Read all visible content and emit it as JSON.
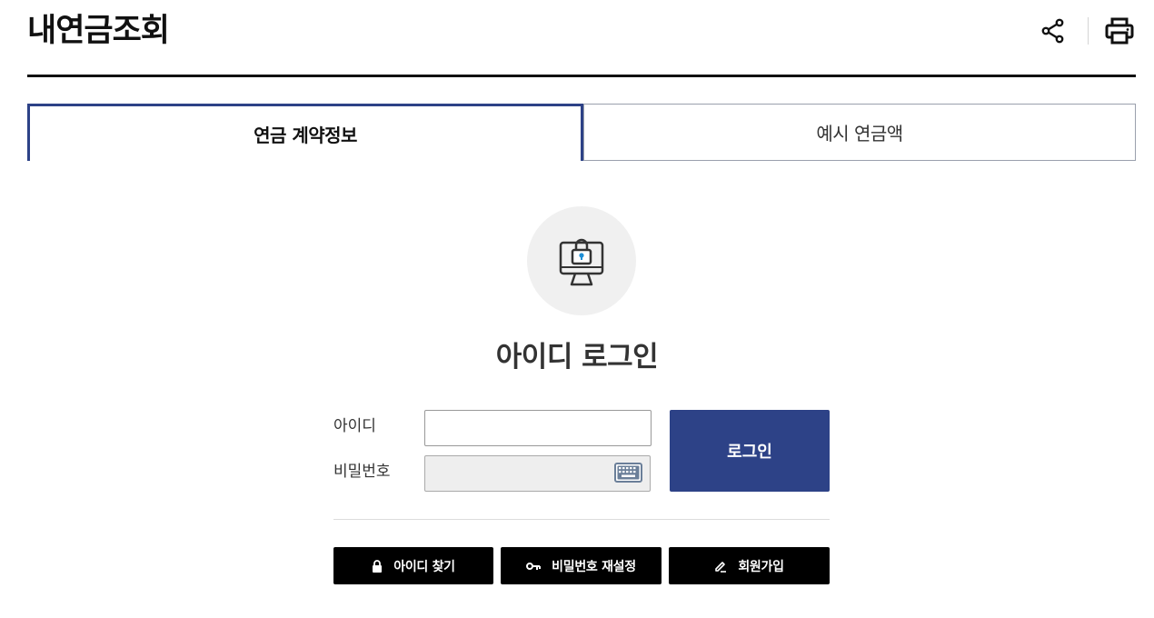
{
  "header": {
    "title": "내연금조회",
    "icons": [
      "share-icon",
      "print-icon"
    ]
  },
  "tabs": [
    {
      "label": "연금 계약정보",
      "active": true
    },
    {
      "label": "예시 연금액",
      "active": false
    }
  ],
  "login": {
    "icon": "computer-lock-icon",
    "title": "아이디 로그인",
    "id_label": "아이디",
    "id_value": "",
    "password_label": "비밀번호",
    "password_value": "",
    "keyboard_icon": "virtual-keyboard-icon",
    "submit_label": "로그인"
  },
  "actions": [
    {
      "label": "아이디 찾기",
      "icon": "lock-icon"
    },
    {
      "label": "비밀번호 재설정",
      "icon": "key-icon"
    },
    {
      "label": "회원가입",
      "icon": "pen-icon"
    }
  ],
  "colors": {
    "accent": "#2d4287",
    "action_button": "#000000",
    "icon_circle": "#f0f0f0",
    "password_field": "#eeeeee"
  }
}
